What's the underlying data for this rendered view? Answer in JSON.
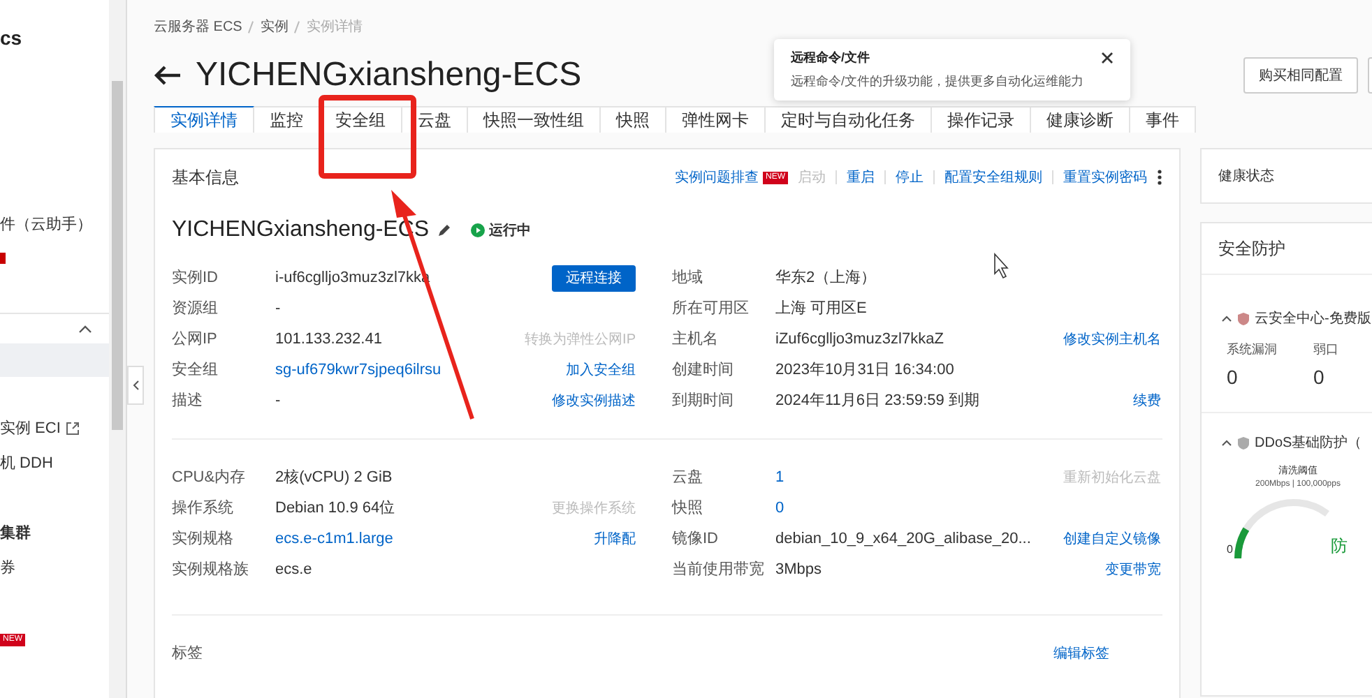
{
  "sidebar": {
    "items": [
      {
        "label": "cs",
        "kind": "title"
      },
      {
        "label": "件（云助手）",
        "kind": "item",
        "selected": false
      },
      {
        "kind": "marker"
      },
      {
        "kind": "section",
        "expanded": true
      },
      {
        "kind": "blank",
        "selected": true
      },
      {
        "label": "实例 ECI",
        "kind": "external",
        "selected": false
      },
      {
        "label": "机 DDH",
        "kind": "item",
        "selected": false
      },
      {
        "label": "集群",
        "kind": "strong",
        "selected": false
      },
      {
        "label": "券",
        "kind": "item",
        "selected": false
      },
      {
        "label": "NEW",
        "kind": "badge"
      }
    ]
  },
  "breadcrumb": [
    "云服务器 ECS",
    "实例",
    "实例详情"
  ],
  "title": "YICHENGxiansheng-ECS",
  "header_buttons": [
    "购买相同配置"
  ],
  "tooltip": {
    "title": "远程命令/文件",
    "text": "远程命令/文件的升级功能，提供更多自动化运维能力"
  },
  "tabs": [
    {
      "label": "实例详情",
      "selected": true
    },
    {
      "label": "监控",
      "selected": false
    },
    {
      "label": "安全组",
      "selected": false
    },
    {
      "label": "云盘",
      "selected": false
    },
    {
      "label": "快照一致性组",
      "selected": false
    },
    {
      "label": "快照",
      "selected": false
    },
    {
      "label": "弹性网卡",
      "selected": false
    },
    {
      "label": "定时与自动化任务",
      "selected": false
    },
    {
      "label": "操作记录",
      "selected": false
    },
    {
      "label": "健康诊断",
      "selected": false
    },
    {
      "label": "事件",
      "selected": false
    }
  ],
  "basic_info": {
    "title": "基本信息",
    "actions": [
      {
        "label": "实例问题排查",
        "badge": "NEW",
        "disabled": false
      },
      {
        "label": "启动",
        "disabled": true
      },
      {
        "label": "重启",
        "disabled": false
      },
      {
        "label": "停止",
        "disabled": false
      },
      {
        "label": "配置安全组规则",
        "disabled": false
      },
      {
        "label": "重置实例密码",
        "disabled": false
      }
    ],
    "instance_name": "YICHENGxiansheng-ECS",
    "status": "运行中",
    "sections": [
      {
        "left": [
          {
            "label": "实例ID",
            "value": "i-uf6cglljo3muz3zl7kka",
            "link": false,
            "action": {
              "label": "远程连接",
              "kind": "primary"
            }
          },
          {
            "label": "资源组",
            "value": "-",
            "link": false
          },
          {
            "label": "公网IP",
            "value": "101.133.232.41",
            "link": false,
            "action": {
              "label": "转换为弹性公网IP",
              "kind": "disabled"
            }
          },
          {
            "label": "安全组",
            "value": "sg-uf679kwr7sjpeq6ilrsu",
            "link": true,
            "action": {
              "label": "加入安全组",
              "kind": "link"
            }
          },
          {
            "label": "描述",
            "value": "-",
            "link": false,
            "action": {
              "label": "修改实例描述",
              "kind": "link"
            }
          }
        ],
        "right": [
          {
            "label": "地域",
            "value": "华东2（上海）",
            "link": false
          },
          {
            "label": "所在可用区",
            "value": "上海 可用区E",
            "link": false
          },
          {
            "label": "主机名",
            "value": "iZuf6cglljo3muz3zl7kkaZ",
            "link": false,
            "action": {
              "label": "修改实例主机名",
              "kind": "link"
            }
          },
          {
            "label": "创建时间",
            "value": "2023年10月31日 16:34:00",
            "link": false
          },
          {
            "label": "到期时间",
            "value": "2024年11月6日 23:59:59 到期",
            "link": false,
            "action": {
              "label": "续费",
              "kind": "link"
            }
          }
        ]
      },
      {
        "left": [
          {
            "label": "CPU&内存",
            "value": "2核(vCPU) 2 GiB",
            "link": false
          },
          {
            "label": "操作系统",
            "value": "Debian 10.9 64位",
            "link": false,
            "action": {
              "label": "更换操作系统",
              "kind": "disabled"
            }
          },
          {
            "label": "实例规格",
            "value": "ecs.e-c1m1.large",
            "link": true,
            "action": {
              "label": "升降配",
              "kind": "link"
            }
          },
          {
            "label": "实例规格族",
            "value": "ecs.e",
            "link": false
          }
        ],
        "right": [
          {
            "label": "云盘",
            "value": "1",
            "link": true,
            "action": {
              "label": "重新初始化云盘",
              "kind": "disabled"
            }
          },
          {
            "label": "快照",
            "value": "0",
            "link": true
          },
          {
            "label": "镜像ID",
            "value": "debian_10_9_x64_20G_alibase_20...",
            "link": false,
            "action": {
              "label": "创建自定义镜像",
              "kind": "link"
            }
          },
          {
            "label": "当前使用带宽",
            "value": "3Mbps",
            "link": false,
            "action": {
              "label": "变更带宽",
              "kind": "link"
            }
          }
        ]
      }
    ],
    "tags": {
      "label": "标签",
      "action": "编辑标签"
    }
  },
  "health": {
    "title": "健康状态"
  },
  "security": {
    "title": "安全防护",
    "groups": [
      {
        "title": "云安全中心-免费版",
        "expanded": true,
        "stats": [
          {
            "label": "系统漏洞",
            "value": "0"
          },
          {
            "label": "弱口",
            "value": "0"
          }
        ]
      },
      {
        "title": "DDoS基础防护（",
        "expanded": true,
        "gauge": {
          "label": "清洗阈值",
          "threshold": "200Mbps | 100,000pps",
          "min": "0",
          "status": "防"
        }
      }
    ]
  }
}
